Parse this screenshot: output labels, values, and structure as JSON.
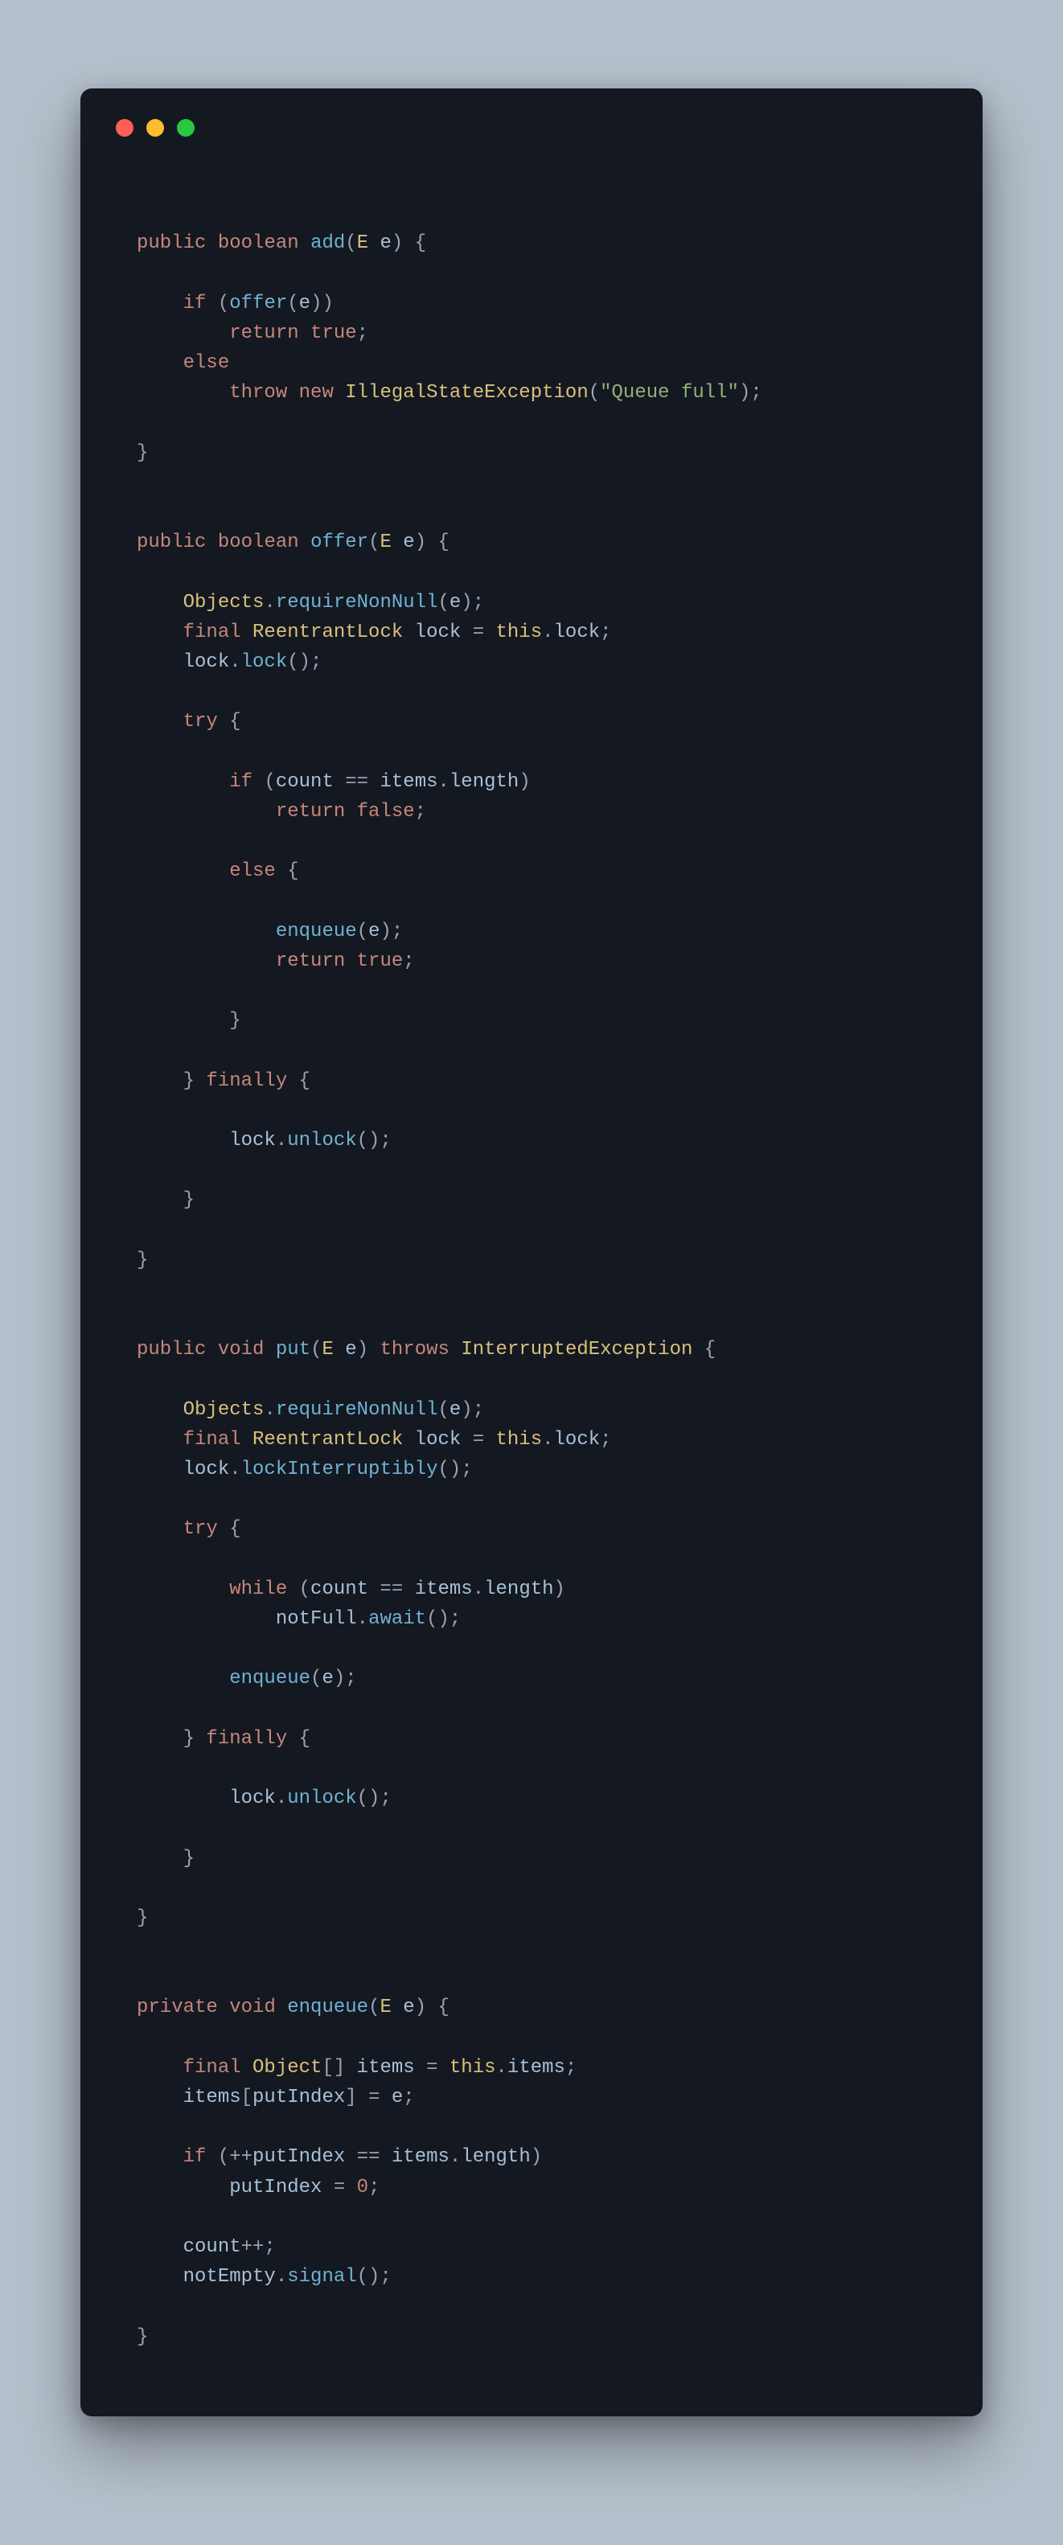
{
  "window": {
    "colors": {
      "close": "#ff5f57",
      "minimize": "#febc2e",
      "zoom": "#28c840"
    }
  },
  "code": {
    "language": "java",
    "tokens": [
      [
        "nl",
        ""
      ],
      [
        "nl",
        ""
      ],
      [
        "kw",
        "public"
      ],
      [
        "sp",
        " "
      ],
      [
        "kw",
        "boolean"
      ],
      [
        "sp",
        " "
      ],
      [
        "fn",
        "add"
      ],
      [
        "punc",
        "("
      ],
      [
        "type",
        "E"
      ],
      [
        "sp",
        " "
      ],
      [
        "var",
        "e"
      ],
      [
        "punc",
        ")"
      ],
      [
        "sp",
        " "
      ],
      [
        "punc",
        "{"
      ],
      [
        "nl",
        ""
      ],
      [
        "nl",
        ""
      ],
      [
        "ind",
        "    "
      ],
      [
        "kw",
        "if"
      ],
      [
        "sp",
        " "
      ],
      [
        "punc",
        "("
      ],
      [
        "fn",
        "offer"
      ],
      [
        "punc",
        "("
      ],
      [
        "var",
        "e"
      ],
      [
        "punc",
        "))"
      ],
      [
        "nl",
        ""
      ],
      [
        "ind",
        "        "
      ],
      [
        "kw",
        "return"
      ],
      [
        "sp",
        " "
      ],
      [
        "bool",
        "true"
      ],
      [
        "punc",
        ";"
      ],
      [
        "nl",
        ""
      ],
      [
        "ind",
        "    "
      ],
      [
        "kw",
        "else"
      ],
      [
        "nl",
        ""
      ],
      [
        "ind",
        "        "
      ],
      [
        "kw",
        "throw"
      ],
      [
        "sp",
        " "
      ],
      [
        "kw",
        "new"
      ],
      [
        "sp",
        " "
      ],
      [
        "type",
        "IllegalStateException"
      ],
      [
        "punc",
        "("
      ],
      [
        "str",
        "\"Queue full\""
      ],
      [
        "punc",
        ");"
      ],
      [
        "nl",
        ""
      ],
      [
        "nl",
        ""
      ],
      [
        "punc",
        "}"
      ],
      [
        "nl",
        ""
      ],
      [
        "nl",
        ""
      ],
      [
        "nl",
        ""
      ],
      [
        "kw",
        "public"
      ],
      [
        "sp",
        " "
      ],
      [
        "kw",
        "boolean"
      ],
      [
        "sp",
        " "
      ],
      [
        "fn",
        "offer"
      ],
      [
        "punc",
        "("
      ],
      [
        "type",
        "E"
      ],
      [
        "sp",
        " "
      ],
      [
        "var",
        "e"
      ],
      [
        "punc",
        ")"
      ],
      [
        "sp",
        " "
      ],
      [
        "punc",
        "{"
      ],
      [
        "nl",
        ""
      ],
      [
        "nl",
        ""
      ],
      [
        "ind",
        "    "
      ],
      [
        "type",
        "Objects"
      ],
      [
        "punc",
        "."
      ],
      [
        "fn",
        "requireNonNull"
      ],
      [
        "punc",
        "("
      ],
      [
        "var",
        "e"
      ],
      [
        "punc",
        ");"
      ],
      [
        "nl",
        ""
      ],
      [
        "ind",
        "    "
      ],
      [
        "kw",
        "final"
      ],
      [
        "sp",
        " "
      ],
      [
        "type",
        "ReentrantLock"
      ],
      [
        "sp",
        " "
      ],
      [
        "var",
        "lock"
      ],
      [
        "sp",
        " "
      ],
      [
        "punc",
        "="
      ],
      [
        "sp",
        " "
      ],
      [
        "this",
        "this"
      ],
      [
        "punc",
        "."
      ],
      [
        "var",
        "lock"
      ],
      [
        "punc",
        ";"
      ],
      [
        "nl",
        ""
      ],
      [
        "ind",
        "    "
      ],
      [
        "var",
        "lock"
      ],
      [
        "punc",
        "."
      ],
      [
        "fn",
        "lock"
      ],
      [
        "punc",
        "();"
      ],
      [
        "nl",
        ""
      ],
      [
        "nl",
        ""
      ],
      [
        "ind",
        "    "
      ],
      [
        "kw",
        "try"
      ],
      [
        "sp",
        " "
      ],
      [
        "punc",
        "{"
      ],
      [
        "nl",
        ""
      ],
      [
        "nl",
        ""
      ],
      [
        "ind",
        "        "
      ],
      [
        "kw",
        "if"
      ],
      [
        "sp",
        " "
      ],
      [
        "punc",
        "("
      ],
      [
        "var",
        "count"
      ],
      [
        "sp",
        " "
      ],
      [
        "punc",
        "=="
      ],
      [
        "sp",
        " "
      ],
      [
        "var",
        "items"
      ],
      [
        "punc",
        "."
      ],
      [
        "var",
        "length"
      ],
      [
        "punc",
        ")"
      ],
      [
        "nl",
        ""
      ],
      [
        "ind",
        "            "
      ],
      [
        "kw",
        "return"
      ],
      [
        "sp",
        " "
      ],
      [
        "bool",
        "false"
      ],
      [
        "punc",
        ";"
      ],
      [
        "nl",
        ""
      ],
      [
        "nl",
        ""
      ],
      [
        "ind",
        "        "
      ],
      [
        "kw",
        "else"
      ],
      [
        "sp",
        " "
      ],
      [
        "punc",
        "{"
      ],
      [
        "nl",
        ""
      ],
      [
        "nl",
        ""
      ],
      [
        "ind",
        "            "
      ],
      [
        "fn",
        "enqueue"
      ],
      [
        "punc",
        "("
      ],
      [
        "var",
        "e"
      ],
      [
        "punc",
        ");"
      ],
      [
        "nl",
        ""
      ],
      [
        "ind",
        "            "
      ],
      [
        "kw",
        "return"
      ],
      [
        "sp",
        " "
      ],
      [
        "bool",
        "true"
      ],
      [
        "punc",
        ";"
      ],
      [
        "nl",
        ""
      ],
      [
        "nl",
        ""
      ],
      [
        "ind",
        "        "
      ],
      [
        "punc",
        "}"
      ],
      [
        "nl",
        ""
      ],
      [
        "nl",
        ""
      ],
      [
        "ind",
        "    "
      ],
      [
        "punc",
        "}"
      ],
      [
        "sp",
        " "
      ],
      [
        "kw",
        "finally"
      ],
      [
        "sp",
        " "
      ],
      [
        "punc",
        "{"
      ],
      [
        "nl",
        ""
      ],
      [
        "nl",
        ""
      ],
      [
        "ind",
        "        "
      ],
      [
        "var",
        "lock"
      ],
      [
        "punc",
        "."
      ],
      [
        "fn",
        "unlock"
      ],
      [
        "punc",
        "();"
      ],
      [
        "nl",
        ""
      ],
      [
        "nl",
        ""
      ],
      [
        "ind",
        "    "
      ],
      [
        "punc",
        "}"
      ],
      [
        "nl",
        ""
      ],
      [
        "nl",
        ""
      ],
      [
        "punc",
        "}"
      ],
      [
        "nl",
        ""
      ],
      [
        "nl",
        ""
      ],
      [
        "nl",
        ""
      ],
      [
        "kw",
        "public"
      ],
      [
        "sp",
        " "
      ],
      [
        "kw",
        "void"
      ],
      [
        "sp",
        " "
      ],
      [
        "fn",
        "put"
      ],
      [
        "punc",
        "("
      ],
      [
        "type",
        "E"
      ],
      [
        "sp",
        " "
      ],
      [
        "var",
        "e"
      ],
      [
        "punc",
        ")"
      ],
      [
        "sp",
        " "
      ],
      [
        "kw",
        "throws"
      ],
      [
        "sp",
        " "
      ],
      [
        "type",
        "InterruptedException"
      ],
      [
        "sp",
        " "
      ],
      [
        "punc",
        "{"
      ],
      [
        "nl",
        ""
      ],
      [
        "nl",
        ""
      ],
      [
        "ind",
        "    "
      ],
      [
        "type",
        "Objects"
      ],
      [
        "punc",
        "."
      ],
      [
        "fn",
        "requireNonNull"
      ],
      [
        "punc",
        "("
      ],
      [
        "var",
        "e"
      ],
      [
        "punc",
        ");"
      ],
      [
        "nl",
        ""
      ],
      [
        "ind",
        "    "
      ],
      [
        "kw",
        "final"
      ],
      [
        "sp",
        " "
      ],
      [
        "type",
        "ReentrantLock"
      ],
      [
        "sp",
        " "
      ],
      [
        "var",
        "lock"
      ],
      [
        "sp",
        " "
      ],
      [
        "punc",
        "="
      ],
      [
        "sp",
        " "
      ],
      [
        "this",
        "this"
      ],
      [
        "punc",
        "."
      ],
      [
        "var",
        "lock"
      ],
      [
        "punc",
        ";"
      ],
      [
        "nl",
        ""
      ],
      [
        "ind",
        "    "
      ],
      [
        "var",
        "lock"
      ],
      [
        "punc",
        "."
      ],
      [
        "fn",
        "lockInterruptibly"
      ],
      [
        "punc",
        "();"
      ],
      [
        "nl",
        ""
      ],
      [
        "nl",
        ""
      ],
      [
        "ind",
        "    "
      ],
      [
        "kw",
        "try"
      ],
      [
        "sp",
        " "
      ],
      [
        "punc",
        "{"
      ],
      [
        "nl",
        ""
      ],
      [
        "nl",
        ""
      ],
      [
        "ind",
        "        "
      ],
      [
        "kw",
        "while"
      ],
      [
        "sp",
        " "
      ],
      [
        "punc",
        "("
      ],
      [
        "var",
        "count"
      ],
      [
        "sp",
        " "
      ],
      [
        "punc",
        "=="
      ],
      [
        "sp",
        " "
      ],
      [
        "var",
        "items"
      ],
      [
        "punc",
        "."
      ],
      [
        "var",
        "length"
      ],
      [
        "punc",
        ")"
      ],
      [
        "nl",
        ""
      ],
      [
        "ind",
        "            "
      ],
      [
        "var",
        "notFull"
      ],
      [
        "punc",
        "."
      ],
      [
        "fn",
        "await"
      ],
      [
        "punc",
        "();"
      ],
      [
        "nl",
        ""
      ],
      [
        "nl",
        ""
      ],
      [
        "ind",
        "        "
      ],
      [
        "fn",
        "enqueue"
      ],
      [
        "punc",
        "("
      ],
      [
        "var",
        "e"
      ],
      [
        "punc",
        ");"
      ],
      [
        "nl",
        ""
      ],
      [
        "nl",
        ""
      ],
      [
        "ind",
        "    "
      ],
      [
        "punc",
        "}"
      ],
      [
        "sp",
        " "
      ],
      [
        "kw",
        "finally"
      ],
      [
        "sp",
        " "
      ],
      [
        "punc",
        "{"
      ],
      [
        "nl",
        ""
      ],
      [
        "nl",
        ""
      ],
      [
        "ind",
        "        "
      ],
      [
        "var",
        "lock"
      ],
      [
        "punc",
        "."
      ],
      [
        "fn",
        "unlock"
      ],
      [
        "punc",
        "();"
      ],
      [
        "nl",
        ""
      ],
      [
        "nl",
        ""
      ],
      [
        "ind",
        "    "
      ],
      [
        "punc",
        "}"
      ],
      [
        "nl",
        ""
      ],
      [
        "nl",
        ""
      ],
      [
        "punc",
        "}"
      ],
      [
        "nl",
        ""
      ],
      [
        "nl",
        ""
      ],
      [
        "nl",
        ""
      ],
      [
        "kw",
        "private"
      ],
      [
        "sp",
        " "
      ],
      [
        "kw",
        "void"
      ],
      [
        "sp",
        " "
      ],
      [
        "fn",
        "enqueue"
      ],
      [
        "punc",
        "("
      ],
      [
        "type",
        "E"
      ],
      [
        "sp",
        " "
      ],
      [
        "var",
        "e"
      ],
      [
        "punc",
        ")"
      ],
      [
        "sp",
        " "
      ],
      [
        "punc",
        "{"
      ],
      [
        "nl",
        ""
      ],
      [
        "nl",
        ""
      ],
      [
        "ind",
        "    "
      ],
      [
        "kw",
        "final"
      ],
      [
        "sp",
        " "
      ],
      [
        "type",
        "Object"
      ],
      [
        "punc",
        "[]"
      ],
      [
        "sp",
        " "
      ],
      [
        "var",
        "items"
      ],
      [
        "sp",
        " "
      ],
      [
        "punc",
        "="
      ],
      [
        "sp",
        " "
      ],
      [
        "this",
        "this"
      ],
      [
        "punc",
        "."
      ],
      [
        "var",
        "items"
      ],
      [
        "punc",
        ";"
      ],
      [
        "nl",
        ""
      ],
      [
        "ind",
        "    "
      ],
      [
        "var",
        "items"
      ],
      [
        "punc",
        "["
      ],
      [
        "var",
        "putIndex"
      ],
      [
        "punc",
        "]"
      ],
      [
        "sp",
        " "
      ],
      [
        "punc",
        "="
      ],
      [
        "sp",
        " "
      ],
      [
        "var",
        "e"
      ],
      [
        "punc",
        ";"
      ],
      [
        "nl",
        ""
      ],
      [
        "nl",
        ""
      ],
      [
        "ind",
        "    "
      ],
      [
        "kw",
        "if"
      ],
      [
        "sp",
        " "
      ],
      [
        "punc",
        "(++"
      ],
      [
        "var",
        "putIndex"
      ],
      [
        "sp",
        " "
      ],
      [
        "punc",
        "=="
      ],
      [
        "sp",
        " "
      ],
      [
        "var",
        "items"
      ],
      [
        "punc",
        "."
      ],
      [
        "var",
        "length"
      ],
      [
        "punc",
        ")"
      ],
      [
        "nl",
        ""
      ],
      [
        "ind",
        "        "
      ],
      [
        "var",
        "putIndex"
      ],
      [
        "sp",
        " "
      ],
      [
        "punc",
        "="
      ],
      [
        "sp",
        " "
      ],
      [
        "num",
        "0"
      ],
      [
        "punc",
        ";"
      ],
      [
        "nl",
        ""
      ],
      [
        "nl",
        ""
      ],
      [
        "ind",
        "    "
      ],
      [
        "var",
        "count"
      ],
      [
        "punc",
        "++;"
      ],
      [
        "nl",
        ""
      ],
      [
        "ind",
        "    "
      ],
      [
        "var",
        "notEmpty"
      ],
      [
        "punc",
        "."
      ],
      [
        "fn",
        "signal"
      ],
      [
        "punc",
        "();"
      ],
      [
        "nl",
        ""
      ],
      [
        "nl",
        ""
      ],
      [
        "punc",
        "}"
      ],
      [
        "nl",
        ""
      ]
    ]
  }
}
